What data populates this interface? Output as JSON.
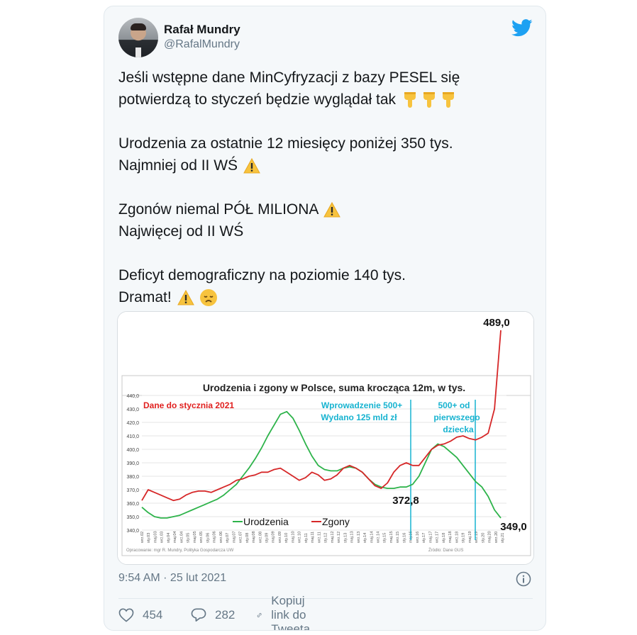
{
  "author": {
    "name": "Rafał Mundry",
    "handle": "@RafalMundry"
  },
  "tweet": {
    "lines": [
      "Jeśli wstępne dane MinCyfryzacji z bazy PESEL się",
      "potwierdzą to styczeń będzie wyglądał tak",
      "Urodzenia za ostatnie 12 miesięcy poniżej 350 tys.",
      "Najmniej od II WŚ",
      "Zgonów niemal PÓŁ MILIONA",
      "Najwięcej od II WŚ",
      "Deficyt demograficzny na poziomie 140 tys.",
      "Dramat!"
    ],
    "emoji": [
      "pointing-down",
      "warning",
      "warning",
      "warning",
      "disappointed-face"
    ]
  },
  "meta": {
    "time": "9:54 AM · 25 lut 2021"
  },
  "actions": {
    "likes": "454",
    "replies": "282",
    "share_label": "Kopiuj link do Tweeta"
  },
  "colors": {
    "twitter_blue": "#1da1f2",
    "births": "#2db34a",
    "deaths": "#d62728",
    "annotation_red": "#e0201f",
    "annotation_cyan": "#17b3d0"
  },
  "chart_data": {
    "type": "line",
    "title": "Urodzenia i zgony w Polsce, suma krocząca 12m, w tys.",
    "ylim": [
      340,
      440
    ],
    "yticks": [
      "440,0",
      "430,0",
      "420,0",
      "410,0",
      "400,0",
      "390,0",
      "380,0",
      "370,0",
      "360,0",
      "350,0",
      "340,0"
    ],
    "xticks": [
      "wrz.02",
      "sty.03",
      "maj.03",
      "wrz.03",
      "sty.04",
      "maj.04",
      "wrz.04",
      "sty.05",
      "maj.05",
      "wrz.05",
      "sty.06",
      "maj.06",
      "wrz.06",
      "sty.07",
      "maj.07",
      "wrz.07",
      "sty.08",
      "maj.08",
      "wrz.08",
      "sty.09",
      "maj.09",
      "wrz.09",
      "sty.10",
      "maj.10",
      "wrz.10",
      "sty.11",
      "maj.11",
      "wrz.11",
      "sty.12",
      "maj.12",
      "wrz.12",
      "sty.13",
      "maj.13",
      "wrz.13",
      "sty.14",
      "maj.14",
      "wrz.14",
      "sty.15",
      "maj.15",
      "wrz.15",
      "sty.16",
      "maj.16",
      "wrz.16",
      "sty.17",
      "maj.17",
      "wrz.17",
      "sty.18",
      "maj.18",
      "wrz.18",
      "sty.19",
      "maj.19",
      "wrz.19",
      "sty.20",
      "maj.20",
      "wrz.20",
      "sty.21"
    ],
    "grid": true,
    "legend": "bottom-left",
    "series": [
      {
        "name": "Urodzenia",
        "values": [
          357,
          353,
          350,
          349,
          349,
          350,
          351,
          353,
          355,
          357,
          359,
          361,
          363,
          366,
          370,
          374,
          380,
          386,
          393,
          401,
          410,
          418,
          426,
          428,
          423,
          414,
          404,
          395,
          388,
          385,
          384,
          384,
          386,
          387,
          386,
          383,
          378,
          374,
          372,
          371,
          371,
          372,
          372,
          374,
          380,
          390,
          400,
          404,
          402,
          398,
          394,
          388,
          382,
          376,
          372,
          365,
          355,
          349
        ]
      },
      {
        "name": "Zgony",
        "values": [
          362,
          370,
          368,
          366,
          364,
          362,
          363,
          366,
          368,
          369,
          369,
          368,
          370,
          372,
          374,
          377,
          378,
          380,
          381,
          383,
          383,
          385,
          386,
          383,
          380,
          377,
          379,
          383,
          381,
          377,
          378,
          381,
          386,
          388,
          386,
          383,
          378,
          373,
          371,
          375,
          383,
          388,
          390,
          388,
          388,
          394,
          400,
          403,
          404,
          406,
          409,
          410,
          408,
          407,
          409,
          412,
          430,
          489
        ]
      }
    ],
    "annotations": [
      "Dane do stycznia 2021",
      "Wprowadzenie 500+",
      "Wydano 125 mld zł",
      "500+ od",
      "pierwszego",
      "dziecka"
    ],
    "data_labels": [
      "489,0",
      "372,8",
      "349,0"
    ],
    "footer_left": "Opracowanie: mgr R. Mundry, Polityka Gospodarcza UW",
    "footer_right": "Źródło: Dane GUS"
  }
}
